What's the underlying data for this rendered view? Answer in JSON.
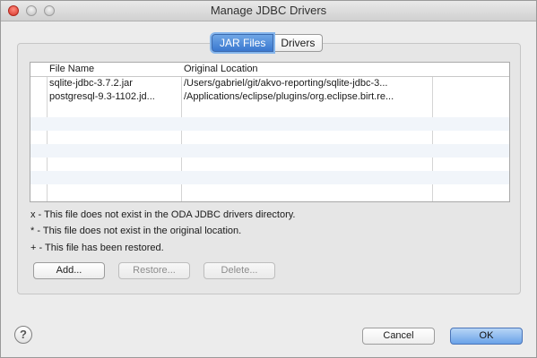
{
  "window": {
    "title": "Manage JDBC Drivers"
  },
  "tabs": [
    {
      "label": "JAR Files",
      "active": true
    },
    {
      "label": "Drivers",
      "active": false
    }
  ],
  "table": {
    "columns": [
      "File Name",
      "Original Location"
    ],
    "rows": [
      {
        "file": "sqlite-jdbc-3.7.2.jar",
        "location": "/Users/gabriel/git/akvo-reporting/sqlite-jdbc-3..."
      },
      {
        "file": "postgresql-9.3-1102.jd...",
        "location": "/Applications/eclipse/plugins/org.eclipse.birt.re..."
      }
    ]
  },
  "legend": [
    "x - This file does not exist in the ODA JDBC drivers directory.",
    "* - This file does not exist in the original location.",
    "+ - This file has been restored."
  ],
  "buttons": {
    "add": "Add...",
    "restore": "Restore...",
    "delete": "Delete...",
    "cancel": "Cancel",
    "ok": "OK"
  },
  "help_icon": "?"
}
